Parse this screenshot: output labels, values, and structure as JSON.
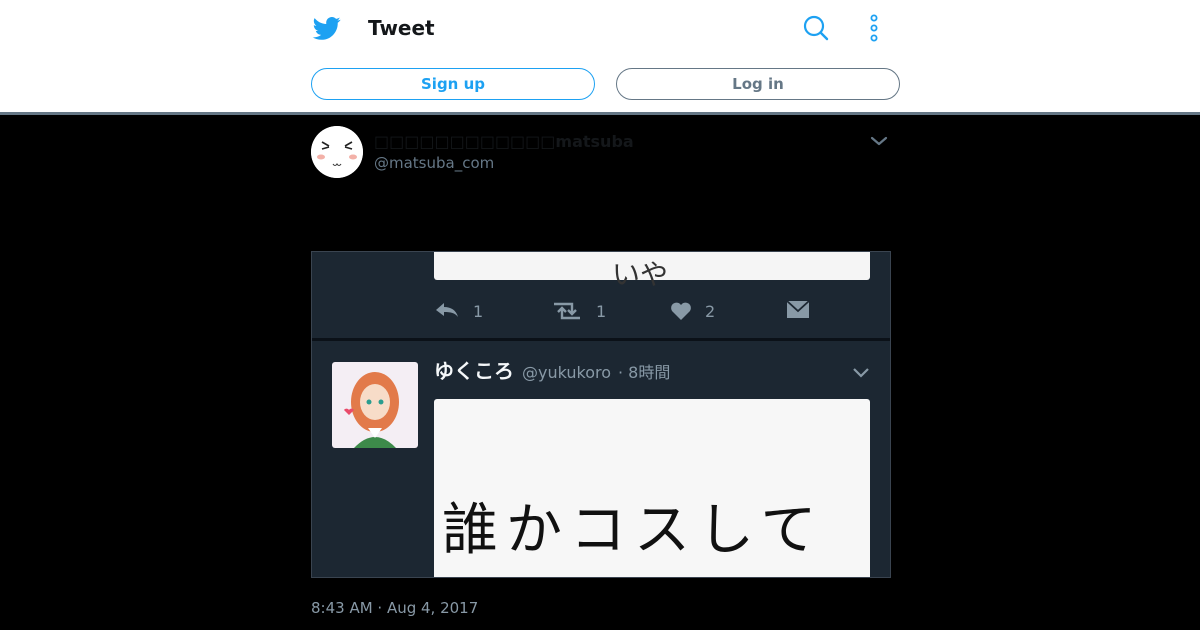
{
  "header": {
    "title": "Tweet",
    "signup_label": "Sign up",
    "login_label": "Log in",
    "icons": {
      "logo": "twitter-bird-icon",
      "search": "search-icon",
      "more": "more-vertical-icon"
    }
  },
  "tweet": {
    "display_name": "□□□□□□□□□□□□matsuba",
    "username": "@matsuba_com",
    "timestamp": "8:43 AM · Aug 4, 2017",
    "media": {
      "embedded_counts": {
        "reply": "1",
        "retweet": "1",
        "like": "2"
      },
      "embedded_user_name": "ゆくころ",
      "embedded_user_handle": "@yukukoro",
      "embedded_time": "· 8時間",
      "embedded_text": "誰かコスして",
      "embedded_top_text": "いや"
    }
  },
  "colors": {
    "accent": "#1da1f2",
    "secondary": "#657786",
    "page_bg": "#000000",
    "media_bg": "#1c2732"
  }
}
